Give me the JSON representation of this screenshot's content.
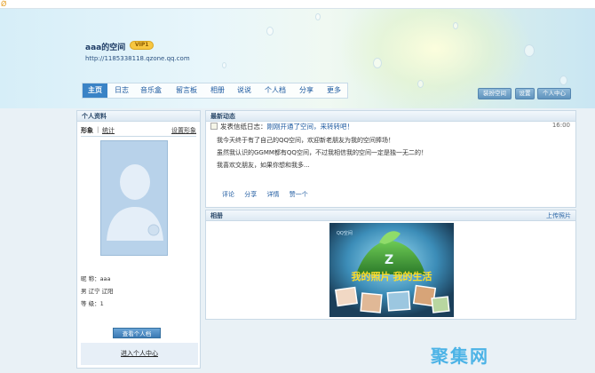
{
  "window": {
    "favicon": "Ǿ"
  },
  "header": {
    "space_title": "aaa的空间",
    "vip_badge": "VIP1",
    "url": "http://1185338118.qzone.qq.com"
  },
  "nav": {
    "items": [
      "主页",
      "日志",
      "音乐盒",
      "留言板",
      "相册",
      "说说",
      "个人档",
      "分享",
      "更多"
    ],
    "active": "主页"
  },
  "toolbar": {
    "decorate_label": "装扮空间",
    "settings_label": "设置",
    "center_label": "个人中心"
  },
  "profile": {
    "panel_title": "个人资料",
    "tab_image": "形象",
    "tab_sep": "|",
    "tab_stats": "统计",
    "set_image": "设置形象",
    "nickname": "昵  称：aaa",
    "location": "男  辽宁  辽阳",
    "level": "等  级：1",
    "view_button": "查看个人档",
    "enter_center": "进入个人中心"
  },
  "feed": {
    "panel_title": "最新动态",
    "item_prefix": "发表信纸日志：",
    "item_link": "刚刚开通了空间，来转转吧！",
    "time": "16:00",
    "lines": [
      "我今天终于有了自己的QQ空间，欢迎新老朋友为我的空间捧场！",
      "虽然我认识的GGMM都有QQ空间，不过我相信我的空间一定是独一无二的！",
      "我喜欢交朋友，如果你想和我多..."
    ],
    "actions": [
      "评论",
      "分享",
      "详情",
      "赞一个"
    ]
  },
  "album": {
    "panel_title": "相册",
    "upload": "上传照片",
    "image_text": "我的照片 我的生活",
    "image_logo": "QQ空间"
  },
  "watermark": {
    "text": "聚集网"
  },
  "colors": {
    "accent": "#3a83c6",
    "link": "#1e5aa0",
    "panel_border": "#c9d9e6"
  }
}
